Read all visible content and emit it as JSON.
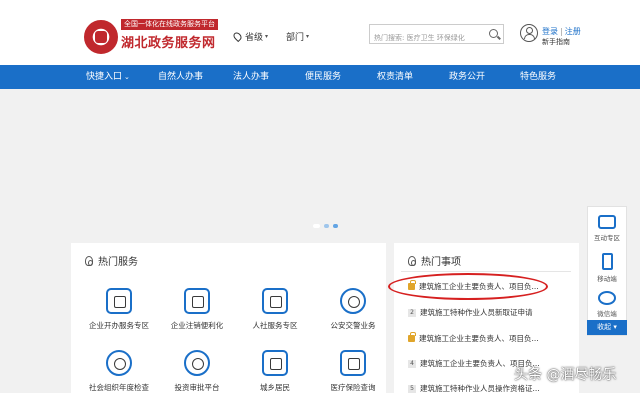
{
  "header": {
    "tagline": "全国一体化在线政务服务平台",
    "site_title": "湖北政务服务网",
    "region_label": "省级",
    "dept_label": "部门",
    "search_placeholder": "热门搜索: 医疗卫生 环保绿化",
    "login": "登录",
    "register": "注册",
    "login_sep": "|",
    "guide": "新手指南"
  },
  "nav": {
    "items": [
      "快捷入口",
      "自然人办事",
      "法人办事",
      "便民服务",
      "权责清单",
      "政务公开",
      "特色服务"
    ]
  },
  "hot_services": {
    "title": "热门服务",
    "items": [
      "企业开办服务专区",
      "企业注销便利化",
      "人社服务专区",
      "公安交警业务",
      "社会组织年度检查",
      "投资审批平台",
      "城乡居民",
      "医疗保险查询"
    ]
  },
  "hot_matters": {
    "title": "热门事项",
    "items": [
      "建筑施工企业主要负责人、项目负...",
      "建筑施工特种作业人员新取证申请",
      "建筑施工企业主要负责人、项目负...",
      "建筑施工企业主要负责人、项目负...",
      "建筑施工特种作业人员操作资格证..."
    ],
    "badges": [
      "",
      "2",
      "",
      "4",
      "5"
    ]
  },
  "float_bar": {
    "interact": "互动专区",
    "mobile": "移动端",
    "wechat": "微信端",
    "collapse": "收起"
  },
  "watermark": "头条 @酒尽畅乐",
  "colors": {
    "brand_red": "#c0282d",
    "nav_blue": "#1a6fc8",
    "annotation_red": "#d62020"
  }
}
